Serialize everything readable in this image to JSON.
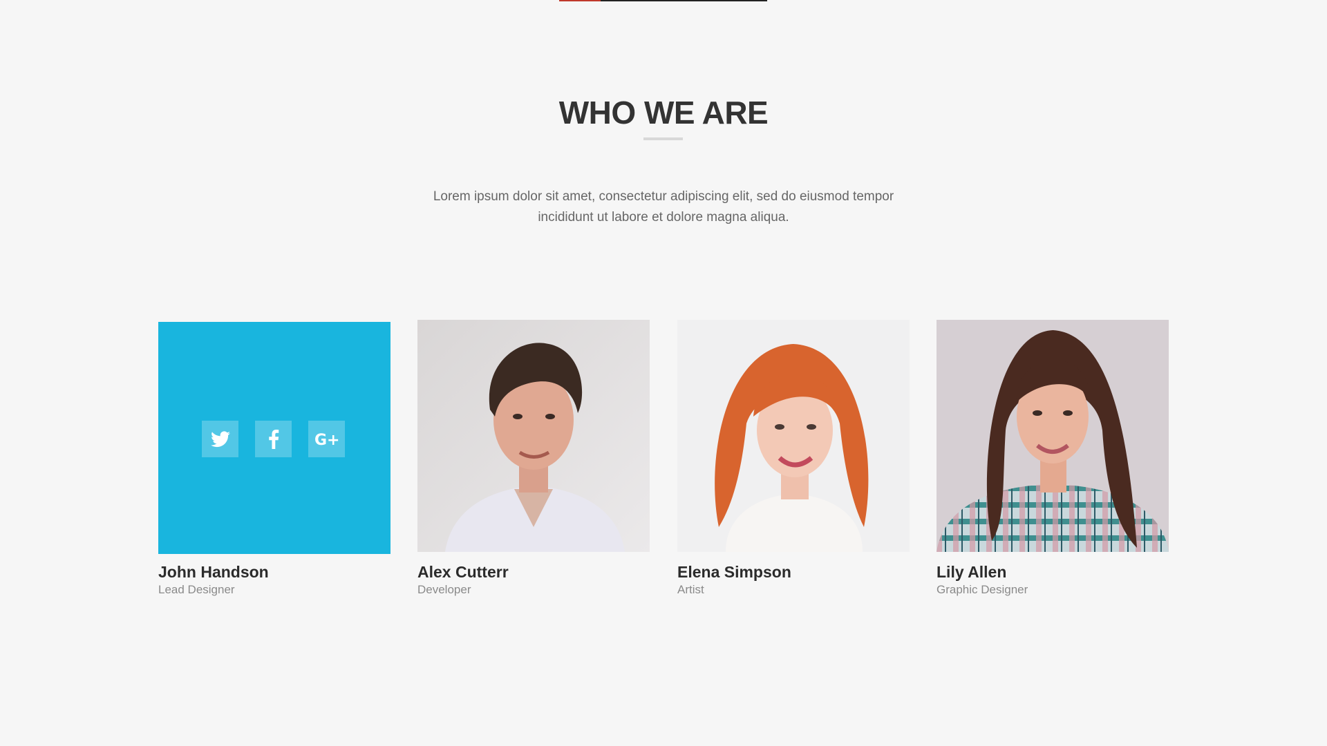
{
  "section": {
    "title": "WHO WE ARE",
    "intro": "Lorem ipsum dolor sit amet, consectetur adipiscing elit, sed do eiusmod tempor incididunt ut labore et dolore magna aliqua."
  },
  "colors": {
    "accent_blue": "#19b5de",
    "background": "#f6f6f6",
    "top_accent": "#c0392b"
  },
  "social_icons": [
    "twitter-icon",
    "facebook-icon",
    "google-plus-icon"
  ],
  "team": [
    {
      "name": "John Handson",
      "role": "Lead Designer"
    },
    {
      "name": "Alex Cutterr",
      "role": "Developer"
    },
    {
      "name": "Elena Simpson",
      "role": "Artist"
    },
    {
      "name": "Lily Allen",
      "role": "Graphic Designer"
    }
  ]
}
